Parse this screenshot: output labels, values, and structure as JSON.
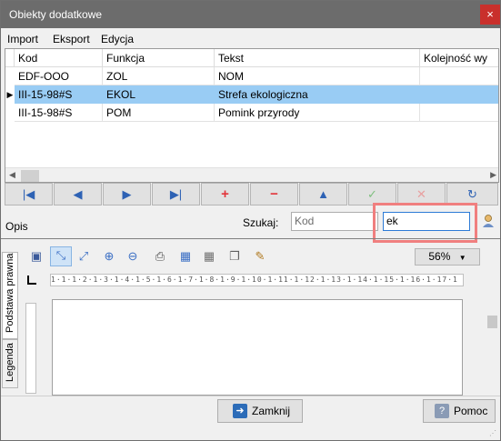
{
  "window": {
    "title": "Obiekty dodatkowe",
    "close_glyph": "×"
  },
  "menu": [
    {
      "label": "Import"
    },
    {
      "label": "Eksport"
    },
    {
      "label": "Edycja"
    }
  ],
  "grid": {
    "columns": [
      "Kod",
      "Funkcja",
      "Tekst",
      "Kolejność wy"
    ],
    "rows": [
      {
        "kod": "EDF-OOO",
        "funkcja": "ZOL",
        "tekst": "NOM",
        "kolejnosc": "",
        "selected": false
      },
      {
        "kod": "III-15-98#S",
        "funkcja": "EKOL",
        "tekst": "Strefa ekologiczna",
        "kolejnosc": "",
        "selected": true
      },
      {
        "kod": "III-15-98#S",
        "funkcja": "POM",
        "tekst": "Pomink przyrody",
        "kolejnosc": "",
        "selected": false
      }
    ],
    "row_indicator": "▶"
  },
  "nav_buttons": [
    {
      "name": "first-record-button",
      "glyph": "|◀"
    },
    {
      "name": "prev-record-button",
      "glyph": "◀"
    },
    {
      "name": "next-record-button",
      "glyph": "▶"
    },
    {
      "name": "last-record-button",
      "glyph": "▶|"
    },
    {
      "name": "add-record-button",
      "glyph": "+"
    },
    {
      "name": "delete-record-button",
      "glyph": "−"
    },
    {
      "name": "edit-record-button",
      "glyph": "▲"
    },
    {
      "name": "confirm-button",
      "glyph": "✓"
    },
    {
      "name": "cancel-edit-button",
      "glyph": "✕"
    },
    {
      "name": "refresh-button",
      "glyph": "↻"
    }
  ],
  "search": {
    "opis_label": "Opis",
    "label": "Szukaj:",
    "field1_value": "Kod",
    "field2_value": "ek"
  },
  "editor": {
    "tabs": [
      "Podstawa prawna",
      "Legenda"
    ],
    "zoom": "56%",
    "ruler_text": "1·1·1·2·1·3·1·4·1·5·1·6·1·7·1·8·1·9·1·10·1·11·1·12·1·13·1·14·1·15·1·16·1·17·1",
    "toolbar_icons": [
      "save-icon",
      "fit-page-icon",
      "fit-width-icon",
      "zoom-in-icon",
      "zoom-out-icon",
      "print-icon",
      "table-icon",
      "table-grid-icon",
      "copy-icon",
      "edit-icon"
    ]
  },
  "buttons": {
    "close_label": "Zamknij",
    "help_label": "Pomoc"
  },
  "colors": {
    "titlebar": "#6c6c6c",
    "selected_row": "#99ccf4",
    "highlight_box": "#f07f7f",
    "accent_blue": "#2e62b4",
    "accent_red": "#e3343a"
  }
}
